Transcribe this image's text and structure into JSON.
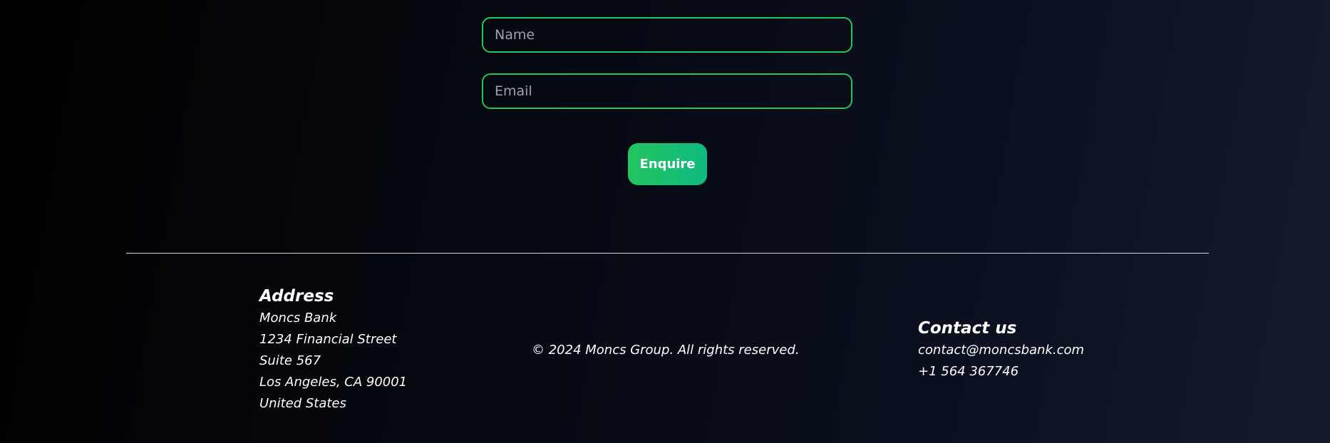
{
  "form": {
    "name_placeholder": "Name",
    "email_placeholder": "Email",
    "submit_label": "Enquire"
  },
  "footer": {
    "address": {
      "heading": "Address",
      "lines": [
        "Moncs Bank",
        "1234 Financial Street",
        "Suite 567",
        "Los Angeles, CA 90001",
        "United States"
      ]
    },
    "copyright": "© 2024 Moncs Group. All rights reserved.",
    "contact": {
      "heading": "Contact us",
      "email": "contact@moncsbank.com",
      "phone": "+1 564 367746"
    }
  },
  "colors": {
    "accent": "#22c55e",
    "background_start": "#000000",
    "background_end": "#141b2c",
    "divider": "#d1d5db"
  }
}
